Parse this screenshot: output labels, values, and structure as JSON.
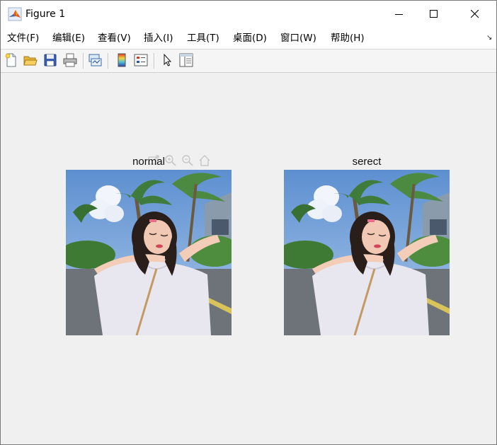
{
  "window": {
    "title": "Figure 1",
    "icon": "matlab-icon",
    "controls": [
      "minimize-icon",
      "maximize-icon",
      "close-icon"
    ]
  },
  "menu": {
    "items": [
      {
        "label": "文件(F)"
      },
      {
        "label": "编辑(E)"
      },
      {
        "label": "查看(V)"
      },
      {
        "label": "插入(I)"
      },
      {
        "label": "工具(T)"
      },
      {
        "label": "桌面(D)"
      },
      {
        "label": "窗口(W)"
      },
      {
        "label": "帮助(H)"
      }
    ],
    "dock_icon": "dock-arrow-icon"
  },
  "toolbar": {
    "tools": [
      "new-figure-icon",
      "open-file-icon",
      "save-icon",
      "print-icon",
      "link-plot-icon",
      "colorbar-icon",
      "legend-icon",
      "pointer-icon",
      "property-inspector-icon"
    ]
  },
  "axes_toolbar": {
    "tools": [
      "export-icon",
      "zoom-in-icon",
      "zoom-out-icon",
      "home-icon"
    ]
  },
  "subplots": [
    {
      "title": "normal",
      "image": "photo of girl in white t-shirt under palm trees"
    },
    {
      "title": "serect",
      "image": "photo of girl in white t-shirt under palm trees"
    }
  ],
  "colors": {
    "titlebar_bg": "#ffffff",
    "figure_bg": "#f0f0f0",
    "sky": "#6fa3d9",
    "shirt": "#e8e6ee"
  }
}
